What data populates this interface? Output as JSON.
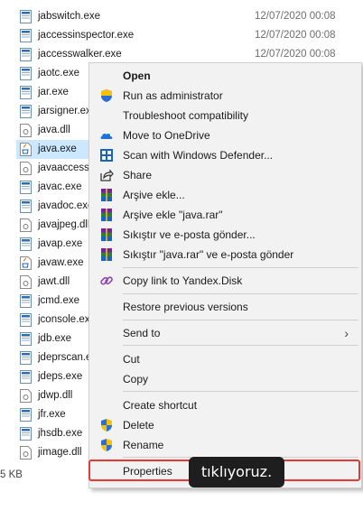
{
  "files": [
    {
      "name": "jabswitch.exe",
      "date": "12/07/2020 00:08",
      "icon": "exe-icon"
    },
    {
      "name": "jaccessinspector.exe",
      "date": "12/07/2020 00:08",
      "icon": "exe-icon"
    },
    {
      "name": "jaccesswalker.exe",
      "date": "12/07/2020 00:08",
      "icon": "exe-icon"
    },
    {
      "name": "jaotc.exe",
      "date": "",
      "icon": "exe-icon"
    },
    {
      "name": "jar.exe",
      "date": "",
      "icon": "exe-icon"
    },
    {
      "name": "jarsigner.exe",
      "date": "",
      "icon": "exe-icon"
    },
    {
      "name": "java.dll",
      "date": "",
      "icon": "dll-icon"
    },
    {
      "name": "java.exe",
      "date": "",
      "icon": "java-icon",
      "selected": true
    },
    {
      "name": "javaaccessb",
      "date": "",
      "icon": "dll-icon"
    },
    {
      "name": "javac.exe",
      "date": "",
      "icon": "exe-icon"
    },
    {
      "name": "javadoc.exe",
      "date": "",
      "icon": "exe-icon"
    },
    {
      "name": "javajpeg.dll",
      "date": "",
      "icon": "dll-icon"
    },
    {
      "name": "javap.exe",
      "date": "",
      "icon": "exe-icon"
    },
    {
      "name": "javaw.exe",
      "date": "",
      "icon": "java-icon"
    },
    {
      "name": "jawt.dll",
      "date": "",
      "icon": "dll-icon"
    },
    {
      "name": "jcmd.exe",
      "date": "",
      "icon": "exe-icon"
    },
    {
      "name": "jconsole.exe",
      "date": "",
      "icon": "exe-icon"
    },
    {
      "name": "jdb.exe",
      "date": "",
      "icon": "exe-icon"
    },
    {
      "name": "jdeprscan.exe",
      "date": "",
      "icon": "exe-icon"
    },
    {
      "name": "jdeps.exe",
      "date": "",
      "icon": "exe-icon"
    },
    {
      "name": "jdwp.dll",
      "date": "",
      "icon": "dll-icon"
    },
    {
      "name": "jfr.exe",
      "date": "",
      "icon": "exe-icon"
    },
    {
      "name": "jhsdb.exe",
      "date": "",
      "icon": "exe-icon"
    },
    {
      "name": "jimage.dll",
      "date": "",
      "icon": "dll-icon"
    }
  ],
  "status_size": "5 KB",
  "menu": {
    "open": "Open",
    "run_as_admin": "Run as administrator",
    "troubleshoot": "Troubleshoot compatibility",
    "onedrive": "Move to OneDrive",
    "defender": "Scan with Windows Defender...",
    "share": "Share",
    "arsiv_ekle": "Arşive ekle...",
    "arsiv_ekle_java": "Arşive ekle \"java.rar\"",
    "sikistir_gonder": "Sıkıştır ve e-posta gönder...",
    "sikistir_java_gonder": "Sıkıştır \"java.rar\" ve e-posta gönder",
    "yandex": "Copy link to Yandex.Disk",
    "restore": "Restore previous versions",
    "send_to": "Send to",
    "cut": "Cut",
    "copy": "Copy",
    "create_shortcut": "Create shortcut",
    "delete": "Delete",
    "rename": "Rename",
    "properties": "Properties"
  },
  "callout_text": "tıklıyoruz.",
  "colors": {
    "highlight": "#e53935",
    "selection": "#cce8ff",
    "callout_bg": "#1e1e1e"
  }
}
